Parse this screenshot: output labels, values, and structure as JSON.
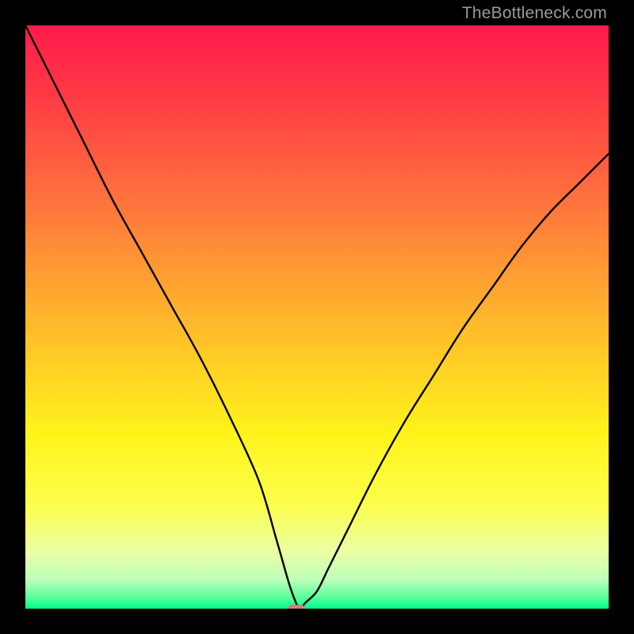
{
  "watermark": {
    "text": "TheBottleneck.com"
  },
  "chart_data": {
    "type": "line",
    "title": "",
    "xlabel": "",
    "ylabel": "",
    "xlim": [
      0,
      100
    ],
    "ylim": [
      0,
      100
    ],
    "grid": false,
    "legend": false,
    "series": [
      {
        "name": "curve",
        "x": [
          0,
          5,
          10,
          15,
          20,
          25,
          30,
          35,
          40,
          43,
          45,
          46,
          47,
          48,
          50,
          52,
          55,
          60,
          65,
          70,
          75,
          80,
          85,
          90,
          95,
          100
        ],
        "y": [
          100,
          90,
          80,
          70,
          61,
          52,
          43,
          33,
          22,
          12,
          5,
          2,
          0,
          1,
          3,
          7,
          13,
          23,
          32,
          40,
          48,
          55,
          62,
          68,
          73,
          78
        ]
      }
    ],
    "marker": {
      "x": 46.5,
      "y": 0,
      "width_pct": 3.0,
      "height_pct": 1.4
    },
    "colors": {
      "curve": "#000000",
      "marker": "#d67c7c",
      "gradient_top": "#ff1a4b",
      "gradient_mid1": "#ff9b33",
      "gradient_mid2": "#fff31a",
      "gradient_bottom": "#00ff89"
    }
  }
}
